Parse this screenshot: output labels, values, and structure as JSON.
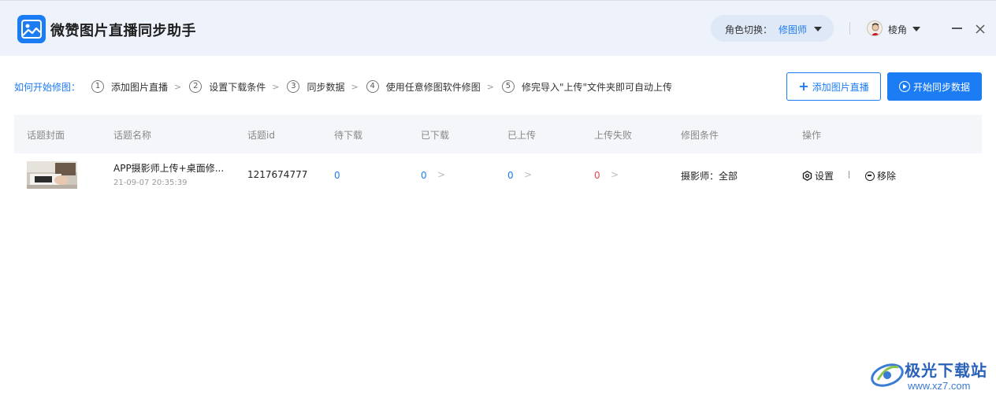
{
  "app": {
    "title": "微赞图片直播同步助手",
    "role_label": "角色切换：",
    "role_value": "修图师",
    "user_name": "棱角"
  },
  "steps": {
    "intro": "如何开始修图：",
    "items": [
      {
        "num": "1",
        "label": "添加图片直播"
      },
      {
        "num": "2",
        "label": "设置下载条件"
      },
      {
        "num": "3",
        "label": "同步数据"
      },
      {
        "num": "4",
        "label": "使用任意修图软件修图"
      },
      {
        "num": "5",
        "label": "修完导入\"上传\"文件夹即可自动上传"
      }
    ]
  },
  "actions": {
    "add_label": "添加图片直播",
    "sync_label": "开始同步数据"
  },
  "table": {
    "headers": [
      "话题封面",
      "话题名称",
      "话题id",
      "待下载",
      "已下载",
      "已上传",
      "上传失败",
      "修图条件",
      "操作"
    ],
    "rows": [
      {
        "name": "APP摄影师上传+桌面修...",
        "time": "21-09-07 20:35:39",
        "id": "1217674777",
        "pending": "0",
        "downloaded": "0",
        "uploaded": "0",
        "failed": "0",
        "condition": "摄影师：全部",
        "op_settings": "设置",
        "op_remove": "移除"
      }
    ]
  },
  "watermark": {
    "text": "极光下载站",
    "url": "www.xz7.com"
  },
  "colors": {
    "accent": "#1c7cf4",
    "header_bg": "#eef3fb",
    "failed": "#e8474b"
  }
}
